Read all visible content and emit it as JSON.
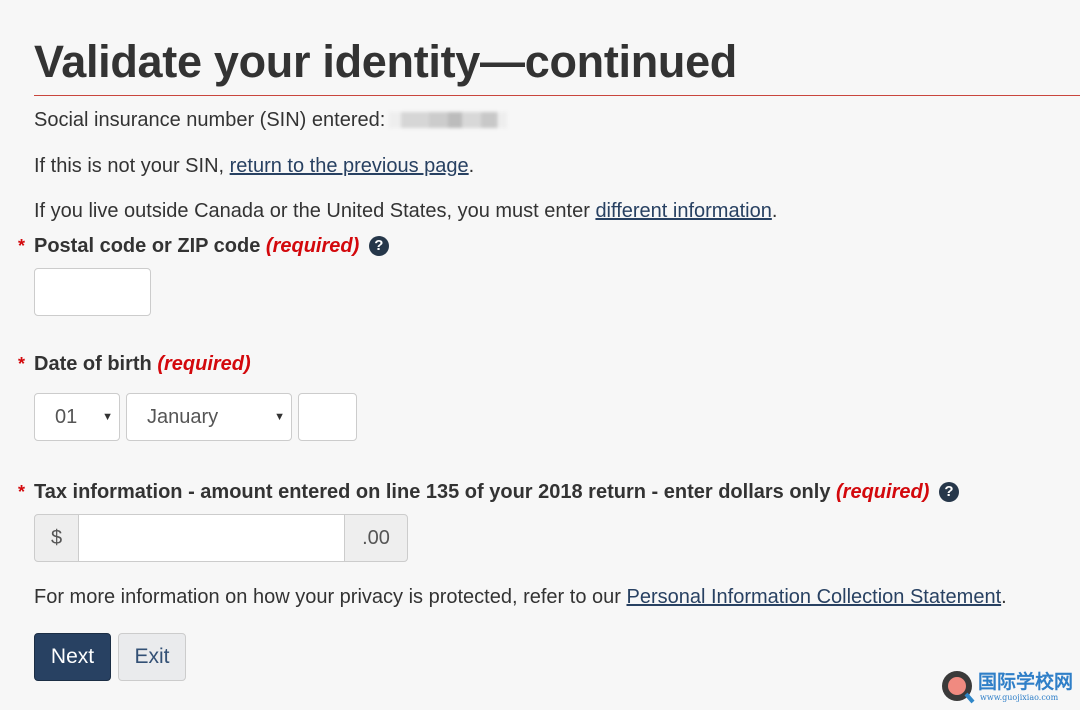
{
  "title": "Validate your identity—continued",
  "sin_text": "Social insurance number (SIN) entered:",
  "not_sin": {
    "prefix": "If this is not your SIN, ",
    "link": "return to the previous page",
    "suffix": "."
  },
  "outside": {
    "prefix": "If you live outside Canada or the United States, you must enter ",
    "link": "different information",
    "suffix": "."
  },
  "postal": {
    "star": "*",
    "label": "Postal code or ZIP code",
    "required": "(required)",
    "help_icon": "?",
    "value": ""
  },
  "dob": {
    "star": "*",
    "label": "Date of birth",
    "required": "(required)",
    "day": "01",
    "month": "January",
    "year": ""
  },
  "tax": {
    "star": "*",
    "label": "Tax information - amount entered on line 135 of your 2018 return - enter dollars only",
    "required": "(required)",
    "help_icon": "?",
    "prefix": "$",
    "suffix": ".00",
    "value": ""
  },
  "privacy": {
    "prefix": "For more information on how your privacy is protected, refer to our ",
    "link": "Personal Information Collection Statement",
    "suffix": "."
  },
  "buttons": {
    "next": "Next",
    "exit": "Exit"
  },
  "colors": {
    "primary": "#284162",
    "required": "#d3080c",
    "rule": "#c9463d"
  },
  "watermark": {
    "name": "国际学校网",
    "url": "www.guojixiao.com"
  }
}
